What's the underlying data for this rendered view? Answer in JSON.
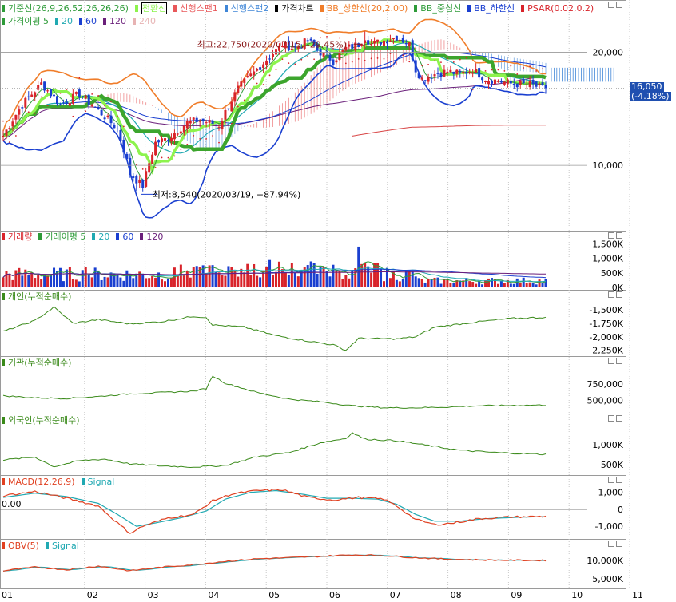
{
  "colors": {
    "up": "#d8232a",
    "down": "#1a3fd0",
    "bb": "#f07d2a",
    "bbmid": "#2e9b39",
    "kijun": "#3ca52d",
    "tenkan": "#8df34d",
    "psar": "#d8232a",
    "cloud_red": "#e8585a",
    "cloud_blue": "#3f86d7",
    "ma120": "#d84545",
    "ma240": "#e7b3b3",
    "ma60": "#6a1f7a",
    "cum": "#3a8a1a",
    "macd": "#e04020",
    "signal": "#20a9b2",
    "obv": "#e04020"
  },
  "legends": {
    "price": [
      {
        "label": "기준선(26,9,26,52,26,26,26)",
        "color": "#2e9b39"
      },
      {
        "label": "전환선",
        "color": "#8df34d",
        "boxed": true
      },
      {
        "label": "선행스팬1",
        "color": "#e8585a"
      },
      {
        "label": "선행스팬2",
        "color": "#3f86d7"
      },
      {
        "label": "가격차트",
        "color": "#000000"
      },
      {
        "label": "BB_상한선(20,2.00)",
        "color": "#f07d2a"
      },
      {
        "label": "BB_중심선",
        "color": "#2e9b39"
      },
      {
        "label": "BB_하한선",
        "color": "#1a3fd0"
      },
      {
        "label": "PSAR(0.02,0.2)",
        "color": "#d8232a"
      }
    ],
    "price2": [
      {
        "label": "가격이평 5",
        "color": "#2e9b39"
      },
      {
        "label": "20",
        "color": "#20a9b2"
      },
      {
        "label": "60",
        "color": "#1a3fd0"
      },
      {
        "label": "120",
        "color": "#6a1f7a"
      },
      {
        "label": "240",
        "color": "#e7b3b3"
      }
    ],
    "volume": [
      {
        "label": "거래량",
        "color": "#d8232a"
      },
      {
        "label": "거래이평 5",
        "color": "#2e9b39"
      },
      {
        "label": "20",
        "color": "#20a9b2"
      },
      {
        "label": "60",
        "color": "#1a3fd0"
      },
      {
        "label": "120",
        "color": "#6a1f7a"
      }
    ],
    "individual": [
      {
        "label": "개인(누적순매수)",
        "color": "#3a8a1a"
      }
    ],
    "institution": [
      {
        "label": "기관(누적순매수)",
        "color": "#3a8a1a"
      }
    ],
    "foreign": [
      {
        "label": "외국인(누적순매수)",
        "color": "#3a8a1a"
      }
    ],
    "macd": [
      {
        "label": "MACD(12,26,9)",
        "color": "#e04020"
      },
      {
        "label": "Signal",
        "color": "#20a9b2"
      }
    ],
    "obv": [
      {
        "label": "OBV(5)",
        "color": "#e04020"
      },
      {
        "label": "Signal",
        "color": "#20a9b2"
      }
    ]
  },
  "annotations": {
    "high": "최고:22,750(2020/07/15, -29.45%)",
    "low": "최저:8,540(2020/03/19, +87.94%)",
    "current_price": "16,050",
    "current_change": "(-4.18%)",
    "macd_zero": "0.00"
  },
  "chart_data": [
    {
      "type": "candlestick",
      "name": "price",
      "ylim": [
        7000,
        25000
      ],
      "yticks": [
        {
          "v": 20000,
          "label": "20,000"
        },
        {
          "v": 10000,
          "label": "10,000"
        }
      ],
      "x_months": [
        "01",
        "02",
        "03",
        "04",
        "05",
        "06",
        "07",
        "08",
        "09",
        "10",
        "11"
      ],
      "anchors": [
        [
          0,
          12000
        ],
        [
          6,
          14500
        ],
        [
          12,
          16500
        ],
        [
          18,
          14500
        ],
        [
          24,
          15500
        ],
        [
          30,
          14000
        ],
        [
          36,
          12500
        ],
        [
          40,
          9500
        ],
        [
          44,
          8800
        ],
        [
          48,
          11500
        ],
        [
          52,
          11800
        ],
        [
          58,
          13000
        ],
        [
          62,
          13200
        ],
        [
          68,
          12800
        ],
        [
          74,
          16000
        ],
        [
          80,
          18000
        ],
        [
          84,
          19500
        ],
        [
          88,
          21000
        ],
        [
          92,
          20500
        ],
        [
          96,
          21500
        ],
        [
          100,
          20000
        ],
        [
          104,
          19000
        ],
        [
          108,
          20500
        ],
        [
          112,
          21000
        ],
        [
          114,
          22000
        ],
        [
          116,
          21000
        ],
        [
          120,
          21500
        ],
        [
          124,
          22000
        ],
        [
          128,
          21000
        ],
        [
          130,
          18000
        ],
        [
          132,
          17000
        ],
        [
          136,
          17500
        ],
        [
          140,
          17800
        ],
        [
          144,
          17500
        ],
        [
          148,
          18000
        ],
        [
          152,
          17000
        ],
        [
          156,
          16800
        ],
        [
          160,
          16500
        ],
        [
          166,
          16400
        ],
        [
          170,
          16050
        ]
      ],
      "high": 22750,
      "low": 8540,
      "last": 16050
    },
    {
      "type": "bar",
      "name": "volume",
      "ylim": [
        0,
        1700000
      ],
      "yticks": [
        {
          "v": 1500000,
          "label": "1,500K"
        },
        {
          "v": 1000000,
          "label": "1,000K"
        },
        {
          "v": 500000,
          "label": "500K"
        },
        {
          "v": 0,
          "label": "0K"
        }
      ]
    },
    {
      "type": "line",
      "name": "individual",
      "ylim": [
        -2300000,
        -1350000
      ],
      "yticks": [
        {
          "v": -1500000,
          "label": "-1,500K"
        },
        {
          "v": -1750000,
          "label": "-1,750K"
        },
        {
          "v": -2000000,
          "label": "-2,000K"
        },
        {
          "v": -2250000,
          "label": "-2,250K"
        }
      ],
      "anchors": [
        [
          0,
          -1900000
        ],
        [
          10,
          -1700000
        ],
        [
          16,
          -1450000
        ],
        [
          22,
          -1750000
        ],
        [
          30,
          -1680000
        ],
        [
          40,
          -1760000
        ],
        [
          50,
          -1720000
        ],
        [
          60,
          -1620000
        ],
        [
          64,
          -1640000
        ],
        [
          66,
          -1780000
        ],
        [
          76,
          -1820000
        ],
        [
          86,
          -1980000
        ],
        [
          96,
          -2080000
        ],
        [
          104,
          -2150000
        ],
        [
          108,
          -2250000
        ],
        [
          112,
          -2030000
        ],
        [
          124,
          -2040000
        ],
        [
          130,
          -2000000
        ],
        [
          136,
          -1820000
        ],
        [
          150,
          -1720000
        ],
        [
          160,
          -1660000
        ],
        [
          170,
          -1640000
        ]
      ]
    },
    {
      "type": "line",
      "name": "institution",
      "ylim": [
        350000,
        1000000
      ],
      "yticks": [
        {
          "v": 750000,
          "label": "750,000"
        },
        {
          "v": 500000,
          "label": "500,000"
        }
      ],
      "anchors": [
        [
          0,
          570000
        ],
        [
          10,
          540000
        ],
        [
          20,
          530000
        ],
        [
          30,
          560000
        ],
        [
          40,
          600000
        ],
        [
          50,
          620000
        ],
        [
          60,
          640000
        ],
        [
          64,
          680000
        ],
        [
          66,
          870000
        ],
        [
          70,
          760000
        ],
        [
          80,
          620000
        ],
        [
          90,
          520000
        ],
        [
          100,
          480000
        ],
        [
          110,
          420000
        ],
        [
          120,
          390000
        ],
        [
          130,
          390000
        ],
        [
          140,
          400000
        ],
        [
          150,
          420000
        ],
        [
          160,
          425000
        ],
        [
          170,
          430000
        ]
      ]
    },
    {
      "type": "line",
      "name": "foreign",
      "ylim": [
        300000,
        1500000
      ],
      "yticks": [
        {
          "v": 1000000,
          "label": "1,000K"
        },
        {
          "v": 500000,
          "label": "500K"
        }
      ],
      "anchors": [
        [
          0,
          620000
        ],
        [
          10,
          690000
        ],
        [
          16,
          450000
        ],
        [
          24,
          600000
        ],
        [
          32,
          640000
        ],
        [
          40,
          520000
        ],
        [
          50,
          470000
        ],
        [
          60,
          440000
        ],
        [
          70,
          480000
        ],
        [
          80,
          700000
        ],
        [
          90,
          800000
        ],
        [
          100,
          1050000
        ],
        [
          108,
          1160000
        ],
        [
          110,
          1300000
        ],
        [
          114,
          1140000
        ],
        [
          124,
          1100000
        ],
        [
          134,
          980000
        ],
        [
          144,
          860000
        ],
        [
          156,
          800000
        ],
        [
          170,
          760000
        ]
      ]
    },
    {
      "type": "line",
      "name": "macd",
      "ylim": [
        -1600000,
        1500000
      ],
      "yticks": [
        {
          "v": 1000000,
          "label": "1,000"
        },
        {
          "v": 0,
          "label": "0"
        },
        {
          "v": -1000000,
          "label": "-1,000"
        }
      ],
      "macd": [
        [
          0,
          800000
        ],
        [
          10,
          1050000
        ],
        [
          20,
          650000
        ],
        [
          30,
          200000
        ],
        [
          36,
          -800000
        ],
        [
          40,
          -1400000
        ],
        [
          44,
          -1000000
        ],
        [
          52,
          -500000
        ],
        [
          60,
          -300000
        ],
        [
          66,
          500000
        ],
        [
          72,
          900000
        ],
        [
          80,
          1100000
        ],
        [
          88,
          1150000
        ],
        [
          96,
          700000
        ],
        [
          104,
          550000
        ],
        [
          112,
          700000
        ],
        [
          120,
          600000
        ],
        [
          124,
          200000
        ],
        [
          130,
          -600000
        ],
        [
          136,
          -900000
        ],
        [
          142,
          -800000
        ],
        [
          150,
          -550000
        ],
        [
          160,
          -450000
        ],
        [
          170,
          -420000
        ]
      ],
      "signal": [
        [
          0,
          700000
        ],
        [
          10,
          950000
        ],
        [
          20,
          750000
        ],
        [
          30,
          350000
        ],
        [
          36,
          -300000
        ],
        [
          42,
          -1000000
        ],
        [
          48,
          -800000
        ],
        [
          56,
          -500000
        ],
        [
          64,
          -100000
        ],
        [
          70,
          600000
        ],
        [
          78,
          1000000
        ],
        [
          86,
          1100000
        ],
        [
          94,
          900000
        ],
        [
          102,
          650000
        ],
        [
          110,
          650000
        ],
        [
          118,
          600000
        ],
        [
          124,
          300000
        ],
        [
          130,
          -300000
        ],
        [
          136,
          -700000
        ],
        [
          144,
          -700000
        ],
        [
          152,
          -550000
        ],
        [
          162,
          -470000
        ],
        [
          170,
          -430000
        ]
      ]
    },
    {
      "type": "line",
      "name": "obv",
      "ylim": [
        3000000,
        14000000
      ],
      "yticks": [
        {
          "v": 10000000,
          "label": "10,000K"
        },
        {
          "v": 5000000,
          "label": "5,000K"
        }
      ],
      "obv": [
        [
          0,
          7200000
        ],
        [
          10,
          8200000
        ],
        [
          20,
          7500000
        ],
        [
          30,
          8500000
        ],
        [
          40,
          7200000
        ],
        [
          50,
          8200000
        ],
        [
          60,
          8900000
        ],
        [
          70,
          9800000
        ],
        [
          80,
          10500000
        ],
        [
          90,
          10800000
        ],
        [
          100,
          11200000
        ],
        [
          110,
          11600000
        ],
        [
          120,
          11400000
        ],
        [
          130,
          10800000
        ],
        [
          140,
          10400000
        ],
        [
          150,
          10200000
        ],
        [
          160,
          10100000
        ],
        [
          170,
          10050000
        ]
      ]
    }
  ]
}
